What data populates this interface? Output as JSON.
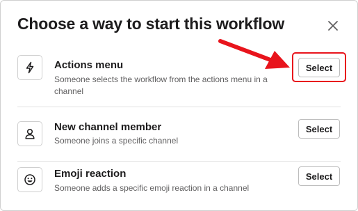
{
  "dialog": {
    "title": "Choose a way to start this workflow",
    "close_icon": "close-icon"
  },
  "options": [
    {
      "icon": "lightning-bolt-icon",
      "title": "Actions menu",
      "description": "Someone selects the workflow from the actions menu in a channel",
      "button_label": "Select",
      "highlighted": true
    },
    {
      "icon": "person-icon",
      "title": "New channel member",
      "description": "Someone joins a specific channel",
      "button_label": "Select",
      "highlighted": false
    },
    {
      "icon": "emoji-icon",
      "title": "Emoji reaction",
      "description": "Someone adds a specific emoji reaction in a channel",
      "button_label": "Select",
      "highlighted": false
    }
  ],
  "annotation": {
    "color": "#e8141c",
    "arrow_icon": "red-arrow-icon"
  }
}
